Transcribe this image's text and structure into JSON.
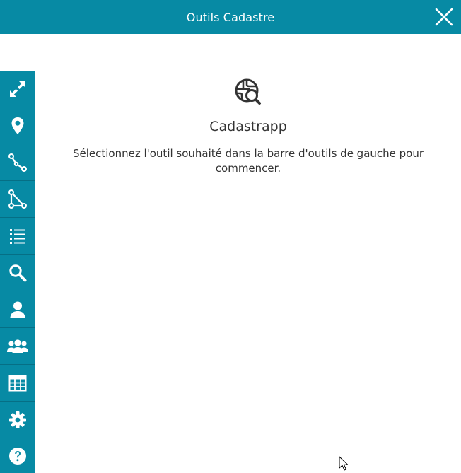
{
  "header": {
    "title": "Outils Cadastre",
    "close_icon": "close-icon"
  },
  "colors": {
    "accent": "#078aa4",
    "text": "#333333"
  },
  "toolbar": {
    "items": [
      {
        "name": "zoom-extent",
        "icon": "expand-arrows-icon"
      },
      {
        "name": "select-point",
        "icon": "map-marker-icon"
      },
      {
        "name": "select-line",
        "icon": "line-draw-icon"
      },
      {
        "name": "select-polygon",
        "icon": "polygon-draw-icon"
      },
      {
        "name": "selection-list",
        "icon": "list-icon"
      },
      {
        "name": "search-plots",
        "icon": "search-icon"
      },
      {
        "name": "search-owner",
        "icon": "user-icon"
      },
      {
        "name": "search-co-owners",
        "icon": "users-group-icon"
      },
      {
        "name": "table-view",
        "icon": "table-icon"
      },
      {
        "name": "preferences",
        "icon": "gear-icon"
      },
      {
        "name": "help",
        "icon": "help-icon"
      }
    ]
  },
  "main": {
    "logo_icon": "globe-search-icon",
    "app_name": "Cadastrapp",
    "instruction": "Sélectionnez l'outil souhaité dans la barre d'outils de gauche pour commencer."
  }
}
